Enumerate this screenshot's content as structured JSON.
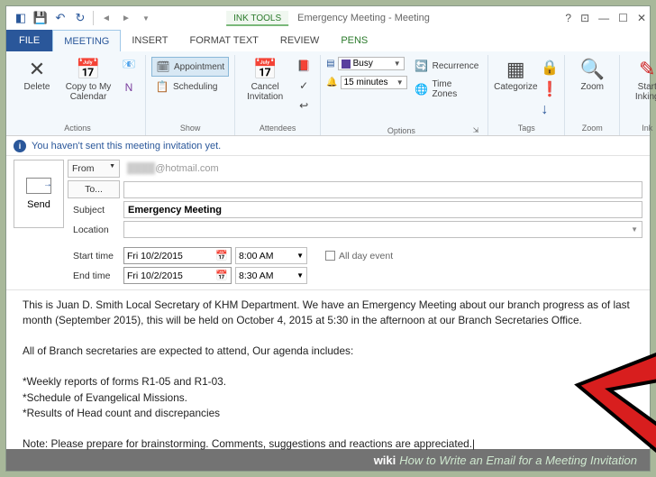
{
  "titlebar": {
    "inktools": "INK TOOLS",
    "title": "Emergency Meeting - Meeting"
  },
  "tabs": {
    "file": "FILE",
    "meeting": "MEETING",
    "insert": "INSERT",
    "format_text": "FORMAT TEXT",
    "review": "REVIEW",
    "pens": "PENS"
  },
  "ribbon": {
    "actions_label": "Actions",
    "delete": "Delete",
    "copy_cal": "Copy to My Calendar",
    "show_label": "Show",
    "appointment": "Appointment",
    "scheduling": "Scheduling",
    "attendees_label": "Attendees",
    "cancel_invitation": "Cancel Invitation",
    "options_label": "Options",
    "busy": "Busy",
    "reminder": "15 minutes",
    "recurrence": "Recurrence",
    "timezones": "Time Zones",
    "tags_label": "Tags",
    "categorize": "Categorize",
    "zoom_label": "Zoom",
    "zoom": "Zoom",
    "ink_label": "Ink",
    "start_inking": "Start Inking"
  },
  "infobar": {
    "message": "You haven't sent this meeting invitation yet."
  },
  "form": {
    "send": "Send",
    "from_label": "From",
    "from_value": "@hotmail.com",
    "to_label": "To...",
    "to_value": "",
    "subject_label": "Subject",
    "subject_value": "Emergency Meeting",
    "location_label": "Location",
    "location_value": "",
    "start_label": "Start time",
    "start_date": "Fri 10/2/2015",
    "start_time": "8:00 AM",
    "end_label": "End time",
    "end_date": "Fri 10/2/2015",
    "end_time": "8:30 AM",
    "allday_label": "All day event"
  },
  "body": "This is Juan D. Smith Local Secretary of KHM Department. We have an Emergency Meeting about our branch progress as of last month (September 2015), this will be held on October 4, 2015 at 5:30 in the afternoon at our Branch Secretaries Office.\n\nAll of Branch secretaries are expected to attend, Our agenda includes:\n\n*Weekly reports of forms R1-05 and R1-03.\n*Schedule of Evangelical Missions.\n*Results of Head count and discrepancies\n\nNote: Please prepare for brainstorming. Comments, suggestions and reactions are appreciated.|",
  "caption": {
    "prefix": "wiki",
    "text": "How to Write an Email for a Meeting Invitation"
  }
}
